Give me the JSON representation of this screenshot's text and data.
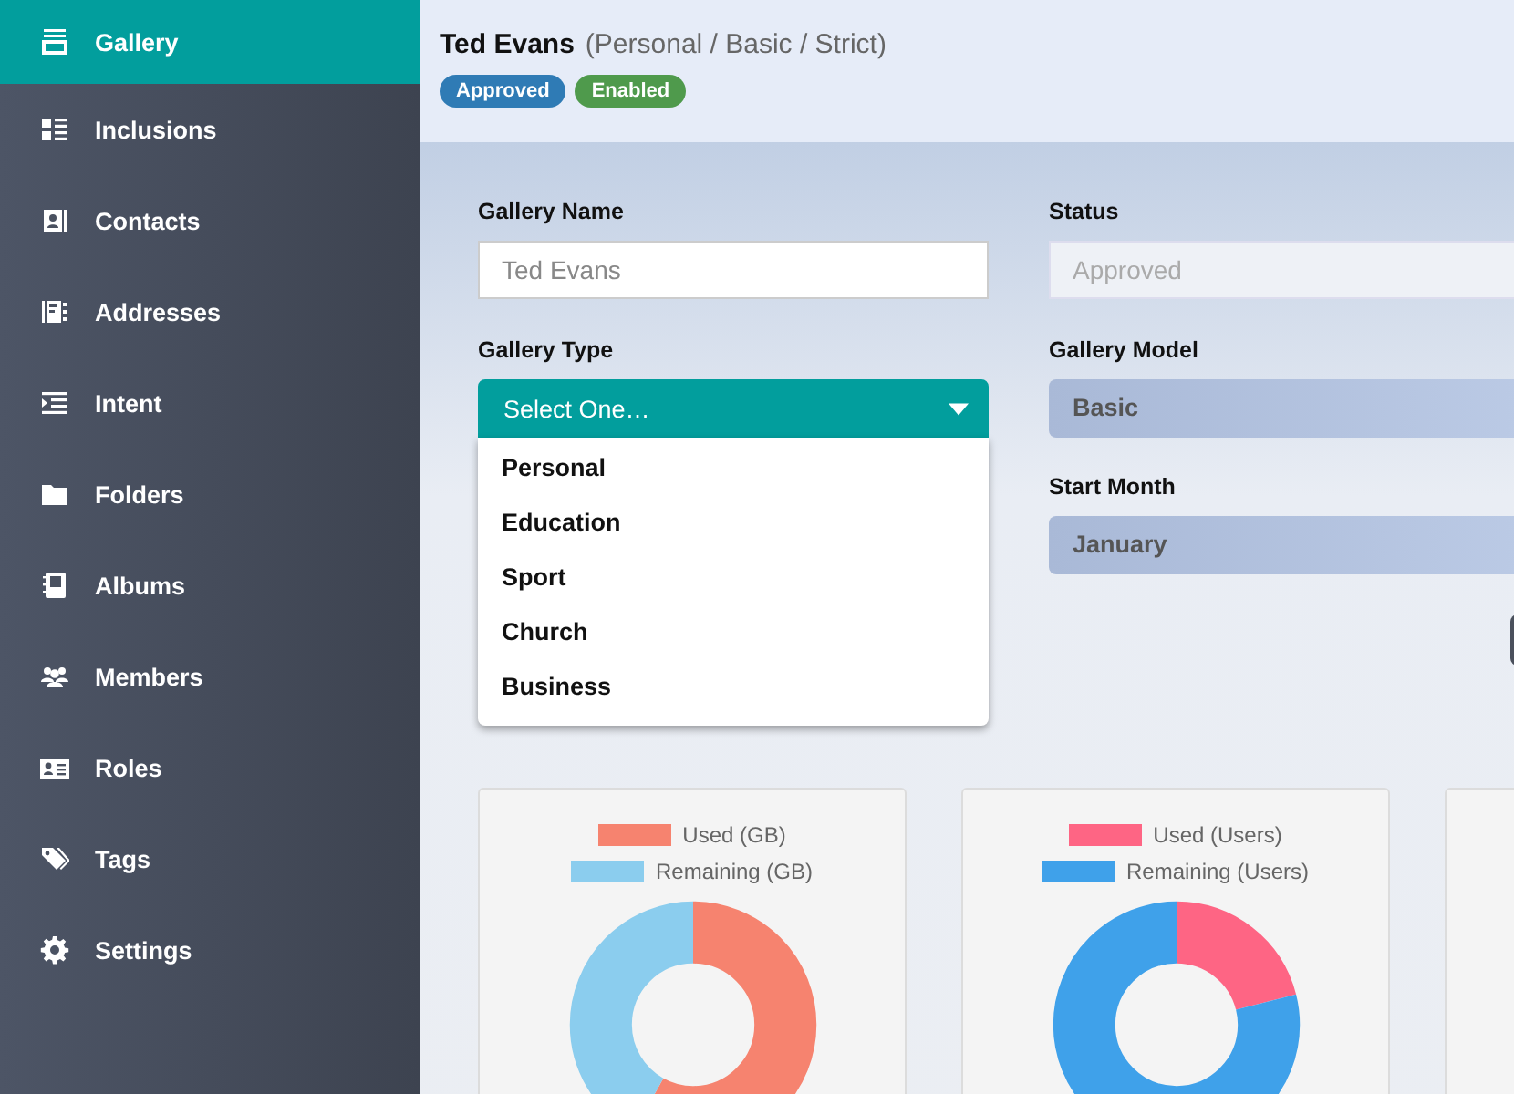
{
  "sidebar": {
    "items": [
      {
        "label": "Gallery",
        "selected": true
      },
      {
        "label": "Inclusions",
        "selected": false
      },
      {
        "label": "Contacts",
        "selected": false
      },
      {
        "label": "Addresses",
        "selected": false
      },
      {
        "label": "Intent",
        "selected": false
      },
      {
        "label": "Folders",
        "selected": false
      },
      {
        "label": "Albums",
        "selected": false
      },
      {
        "label": "Members",
        "selected": false
      },
      {
        "label": "Roles",
        "selected": false
      },
      {
        "label": "Tags",
        "selected": false
      },
      {
        "label": "Settings",
        "selected": false
      }
    ]
  },
  "header": {
    "title": "Ted Evans",
    "subtitle": "(Personal / Basic / Strict)",
    "badges": [
      {
        "label": "Approved",
        "color": "#2f7bb5"
      },
      {
        "label": "Enabled",
        "color": "#4f9a4c"
      }
    ]
  },
  "form": {
    "gallery_name": {
      "label": "Gallery Name",
      "value": "Ted Evans"
    },
    "status": {
      "label": "Status",
      "value": "Approved",
      "disabled": true
    },
    "gallery_type": {
      "label": "Gallery Type",
      "value": "Select One…",
      "expanded": true,
      "options": [
        "Personal",
        "Education",
        "Sport",
        "Church",
        "Business"
      ]
    },
    "gallery_model": {
      "label": "Gallery Model",
      "value": "Basic"
    },
    "start_month": {
      "label": "Start Month",
      "value": "January"
    }
  },
  "charts": [
    {
      "legend": [
        {
          "label": "Used (GB)",
          "color": "#f6836f"
        },
        {
          "label": "Remaining (GB)",
          "color": "#8bcdee"
        }
      ]
    },
    {
      "legend": [
        {
          "label": "Used (Users)",
          "color": "#fe6584"
        },
        {
          "label": "Remaining (Users)",
          "color": "#3fa1ea"
        }
      ]
    }
  ]
}
